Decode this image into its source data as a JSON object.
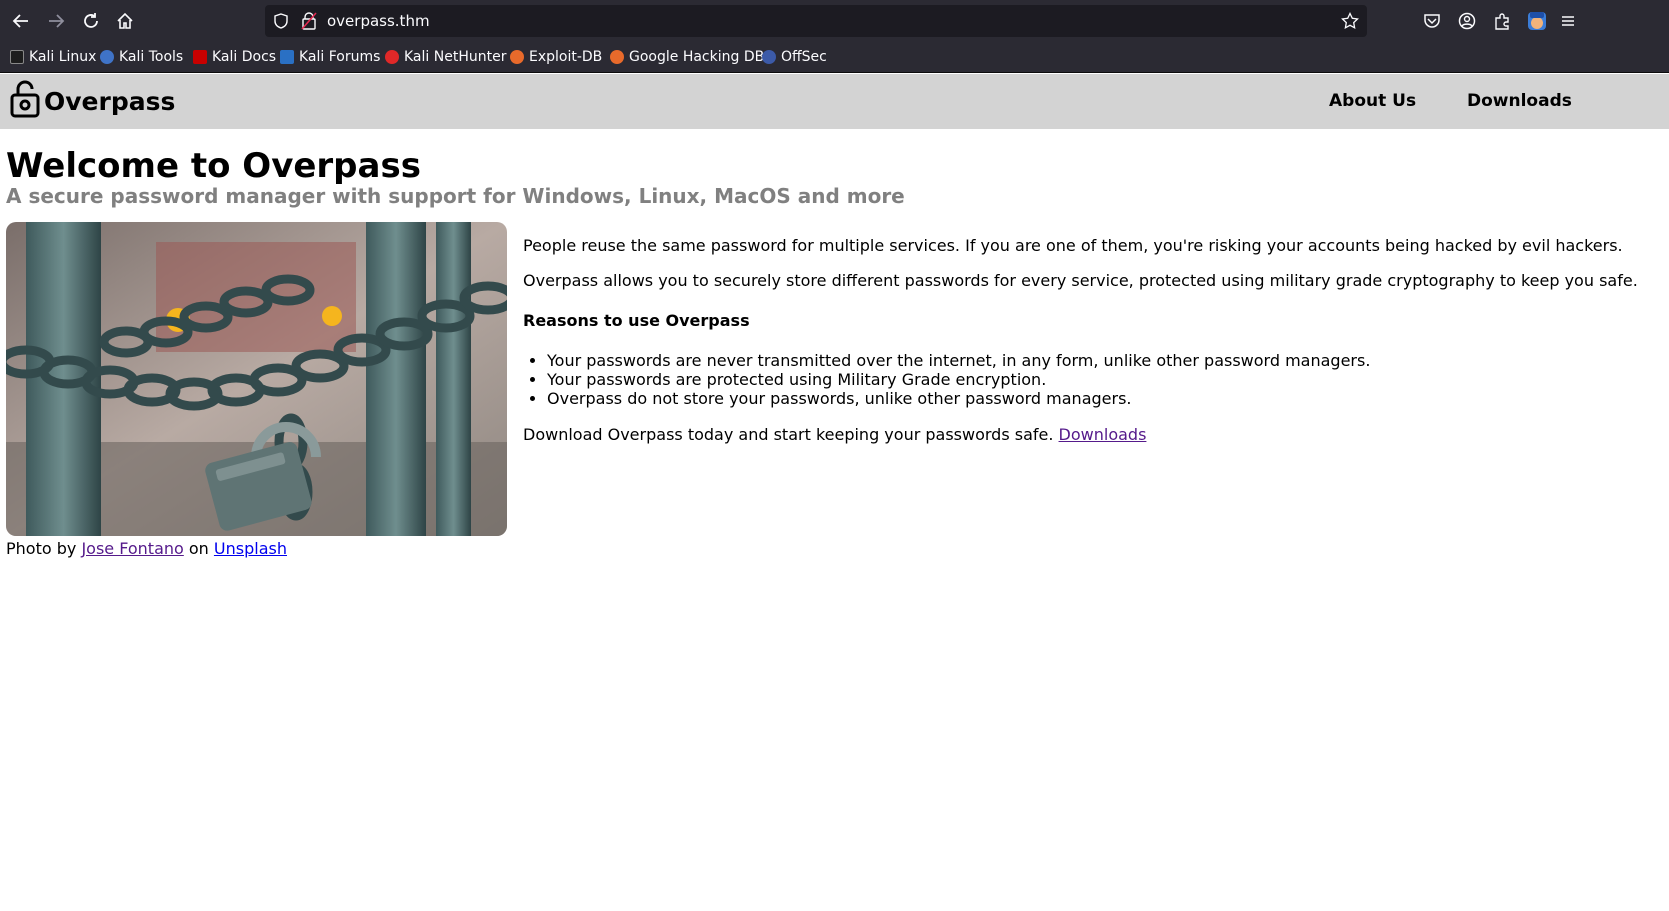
{
  "browser": {
    "url": "overpass.thm",
    "bookmarks": [
      {
        "label": "Kali Linux",
        "color": "#367bf0"
      },
      {
        "label": "Kali Tools",
        "color": "#3f73c7"
      },
      {
        "label": "Kali Docs",
        "color": "#c80000"
      },
      {
        "label": "Kali Forums",
        "color": "#2a70c4"
      },
      {
        "label": "Kali NetHunter",
        "color": "#e02828"
      },
      {
        "label": "Exploit-DB",
        "color": "#e86a2b"
      },
      {
        "label": "Google Hacking DB",
        "color": "#e86a2b"
      },
      {
        "label": "OffSec",
        "color": "#3c5aa8"
      }
    ]
  },
  "site": {
    "brand": "Overpass",
    "nav": [
      "About Us",
      "Downloads"
    ]
  },
  "hero": {
    "title": "Welcome to Overpass",
    "subtitle": "A secure password manager with support for Windows, Linux, MacOS and more"
  },
  "caption": {
    "prefix": "Photo by",
    "author": "Jose Fontano",
    "middle": "on",
    "source": "Unsplash"
  },
  "article": {
    "p1": "People reuse the same password for multiple services. If you are one of them, you're risking your accounts being hacked by evil hackers.",
    "p2": "Overpass allows you to securely store different passwords for every service, protected using military grade cryptography to keep you safe.",
    "reasons_heading": "Reasons to use Overpass",
    "reasons": [
      "Your passwords are never transmitted over the internet, in any form, unlike other password managers.",
      "Your passwords are protected using Military Grade encryption.",
      "Overpass do not store your passwords, unlike other password managers."
    ],
    "cta_text": "Download Overpass today and start keeping your passwords safe.",
    "cta_link": "Downloads"
  }
}
